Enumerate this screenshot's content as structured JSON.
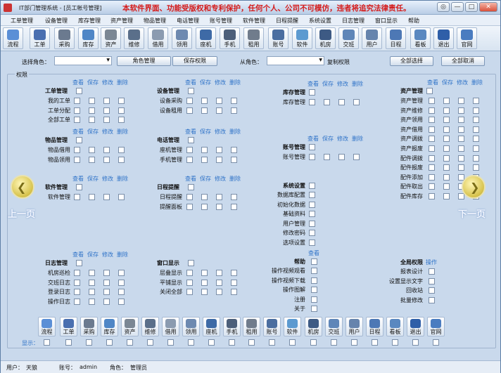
{
  "window": {
    "title": "IT部门管理系统 - [员工帐号管理]",
    "warning": "本软件界面、功能受版权和专利保护，任何个人、公司不可模仿，违者将追究法律责任。",
    "buttons": [
      "◎",
      "—",
      "□",
      "✕"
    ]
  },
  "menu": [
    "工单管理",
    "设备管理",
    "库存管理",
    "资产管理",
    "物品管理",
    "电话管理",
    "账号管理",
    "软件管理",
    "日程提醒",
    "系统设置",
    "日志管理",
    "窗口显示",
    "帮助"
  ],
  "toolbar": [
    {
      "label": "流程",
      "icon": "flow-icon",
      "color": "#5b8fd6"
    },
    {
      "label": "工单",
      "icon": "ticket-icon",
      "color": "#4a6fb0"
    },
    {
      "label": "采购",
      "icon": "cart-icon",
      "color": "#6b7a8f"
    },
    {
      "label": "库存",
      "icon": "box-icon",
      "color": "#4f86c6"
    },
    {
      "label": "资产",
      "icon": "server-icon",
      "color": "#7b8794"
    },
    {
      "label": "维修",
      "icon": "tools-icon",
      "color": "#5a6f8a"
    },
    {
      "label": "借用",
      "icon": "hand-icon",
      "color": "#8b9bb0"
    },
    {
      "label": "领用",
      "icon": "receive-icon",
      "color": "#6d89b0"
    },
    {
      "label": "座机",
      "icon": "phone-icon",
      "color": "#3e6aa6"
    },
    {
      "label": "手机",
      "icon": "mobile-icon",
      "color": "#4c5f7a"
    },
    {
      "label": "租用",
      "icon": "printer-icon",
      "color": "#707c8c"
    },
    {
      "label": "账号",
      "icon": "lock-icon",
      "color": "#4b6ea0"
    },
    {
      "label": "软件",
      "icon": "disc-icon",
      "color": "#5c9ad0"
    },
    {
      "label": "机房",
      "icon": "rack-icon",
      "color": "#3d5a84"
    },
    {
      "label": "交班",
      "icon": "handover-icon",
      "color": "#5f86b8"
    },
    {
      "label": "用户",
      "icon": "user-icon",
      "color": "#6684ad"
    },
    {
      "label": "日程",
      "icon": "calendar-icon",
      "color": "#4d78b5"
    },
    {
      "label": "看板",
      "icon": "board-icon",
      "color": "#5a88c0"
    },
    {
      "label": "退出",
      "icon": "exit-icon",
      "color": "#2f5fa8"
    },
    {
      "label": "官网",
      "icon": "home-icon",
      "color": "#4a7cc0"
    }
  ],
  "rolebar": {
    "role_label": "选择角色：",
    "role_manage": "角色管理",
    "save_perm": "保存权限",
    "from_label": "从角色：",
    "copy_perm": "复制权限",
    "select_all": "全部选择",
    "cancel_all": "全部取消"
  },
  "perm_panel": {
    "title": "权限",
    "cols": [
      "查看",
      "保存",
      "修改",
      "删除"
    ],
    "prev": "上一页",
    "next": "下一页",
    "display_label": "显示："
  },
  "groups": {
    "ticket": {
      "title": "工单管理",
      "items": [
        "我的工单",
        "工单分配",
        "全部工单"
      ]
    },
    "device": {
      "title": "设备管理",
      "items": [
        "设备采购",
        "设备租用"
      ]
    },
    "stock": {
      "title": "库存管理",
      "items": [
        "库存管理"
      ]
    },
    "asset": {
      "title": "资产管理",
      "items": [
        "资产管理",
        "资产维修",
        "资产领用",
        "资产借用",
        "资产调拨",
        "资产报废",
        "配件调拨",
        "配件报废",
        "配件添加",
        "配件取出",
        "配件库存"
      ]
    },
    "goods": {
      "title": "物品管理",
      "items": [
        "物品借用",
        "物品领用"
      ]
    },
    "phone": {
      "title": "电话管理",
      "items": [
        "座机管理",
        "手机管理"
      ]
    },
    "account": {
      "title": "账号管理",
      "items": [
        "账号管理"
      ]
    },
    "software": {
      "title": "软件管理",
      "items": [
        "软件管理"
      ]
    },
    "schedule": {
      "title": "日程提醒",
      "items": [
        "日程提醒",
        "提醒面板"
      ]
    },
    "system": {
      "title": "系统设置",
      "items": [
        "数据库配置",
        "初始化数据",
        "基础资料",
        "用户管理",
        "修改密码",
        "选项设置"
      ]
    },
    "log": {
      "title": "日志管理",
      "items": [
        "机房巡检",
        "交班日志",
        "登录日志",
        "操作日志"
      ]
    },
    "window": {
      "title": "窗口显示",
      "items": [
        "层叠显示",
        "平铺显示",
        "关闭全部"
      ]
    },
    "help": {
      "title": "帮助",
      "items": [
        "操作视频观看",
        "操作视频下载",
        "操作图解",
        "注册",
        "关于"
      ]
    },
    "global": {
      "title": "全局权限",
      "header": "操作",
      "items": [
        "报表设计",
        "设置显示文字",
        "回收站",
        "批量修改"
      ]
    }
  },
  "status": {
    "user_label": "用户：",
    "user": "天狼",
    "account_label": "账号：",
    "account": "admin",
    "role_label": "角色：",
    "role": "管理员"
  }
}
